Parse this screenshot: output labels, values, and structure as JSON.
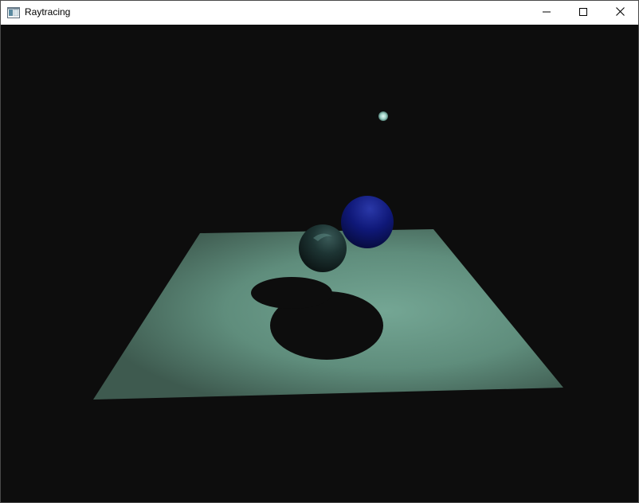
{
  "window": {
    "title": "Raytracing",
    "icon": "app-window-icon",
    "controls": {
      "minimize_icon": "minimize-icon",
      "maximize_icon": "maximize-icon",
      "close_icon": "close-icon"
    }
  },
  "scene": {
    "background_color": "#0d0d0d",
    "plane_color": "#6a9a88",
    "plane_edge_color": "#4b6e60",
    "shadow_color": "#0d0d0d",
    "sphere_dark_color": "#1e3535",
    "sphere_blue_color": "#101a7a",
    "light_color": "#b8e0d8"
  }
}
